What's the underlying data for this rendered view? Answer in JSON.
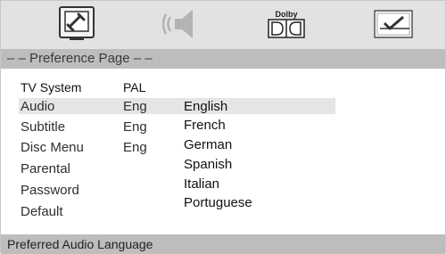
{
  "icons": [
    {
      "name": "general-setup-icon"
    },
    {
      "name": "audio-speaker-icon"
    },
    {
      "name": "dolby-icon",
      "label": "Dolby"
    },
    {
      "name": "preference-check-icon"
    }
  ],
  "header": {
    "title": "– – Preference Page – –"
  },
  "menu": [
    {
      "label": "TV System",
      "value": "PAL"
    },
    {
      "label": "Audio",
      "value": "Eng"
    },
    {
      "label": "Subtitle",
      "value": "Eng"
    },
    {
      "label": "Disc Menu",
      "value": "Eng"
    },
    {
      "label": "Parental",
      "value": ""
    },
    {
      "label": "Password",
      "value": ""
    },
    {
      "label": "Default",
      "value": ""
    }
  ],
  "options": [
    "English",
    "French",
    "German",
    "Spanish",
    "Italian",
    "Portuguese"
  ],
  "footer": {
    "hint": "Preferred Audio Language"
  }
}
